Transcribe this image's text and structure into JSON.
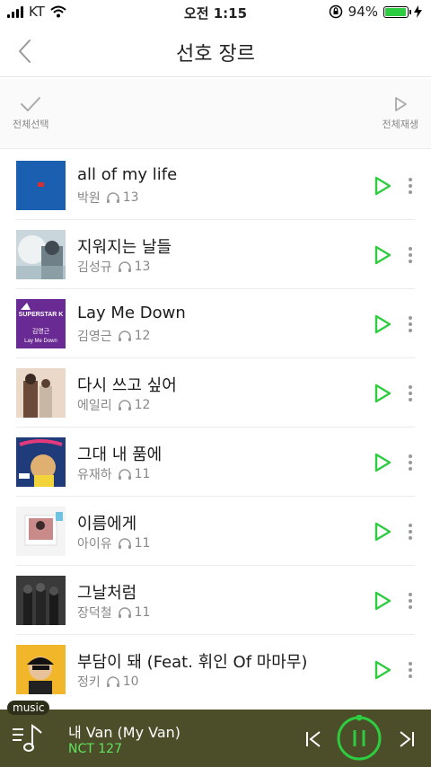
{
  "status_bar": {
    "carrier": "KT",
    "time": "오전 1:15",
    "battery_percent": "94%",
    "battery_level": 0.94
  },
  "header": {
    "title": "선호 장르"
  },
  "toolbar": {
    "select_all_label": "전체선택",
    "play_all_label": "전체재생"
  },
  "songs": [
    {
      "title": "all of my life",
      "artist": "박원",
      "plays": "13"
    },
    {
      "title": "지워지는 날들",
      "artist": "김성규",
      "plays": "13"
    },
    {
      "title": "Lay Me Down",
      "artist": "김영근",
      "plays": "12"
    },
    {
      "title": "다시 쓰고 싶어",
      "artist": "에일리",
      "plays": "12"
    },
    {
      "title": "그대 내 품에",
      "artist": "유재하",
      "plays": "11"
    },
    {
      "title": "이름에게",
      "artist": "아이유",
      "plays": "11"
    },
    {
      "title": "그날처럼",
      "artist": "장덕철",
      "plays": "11"
    },
    {
      "title": "부담이 돼 (Feat. 휘인 Of 마마무)",
      "artist": "정키",
      "plays": "10"
    }
  ],
  "album_art": {
    "cover3_badge": "SUPERSTAR K",
    "cover3_name": "김영근",
    "cover3_song": "Lay Me Down"
  },
  "player": {
    "tag": "music",
    "title": "내 Van (My Van)",
    "artist": "NCT 127"
  },
  "colors": {
    "accent_green": "#2ecc40",
    "player_bg": "#4b4e28"
  }
}
